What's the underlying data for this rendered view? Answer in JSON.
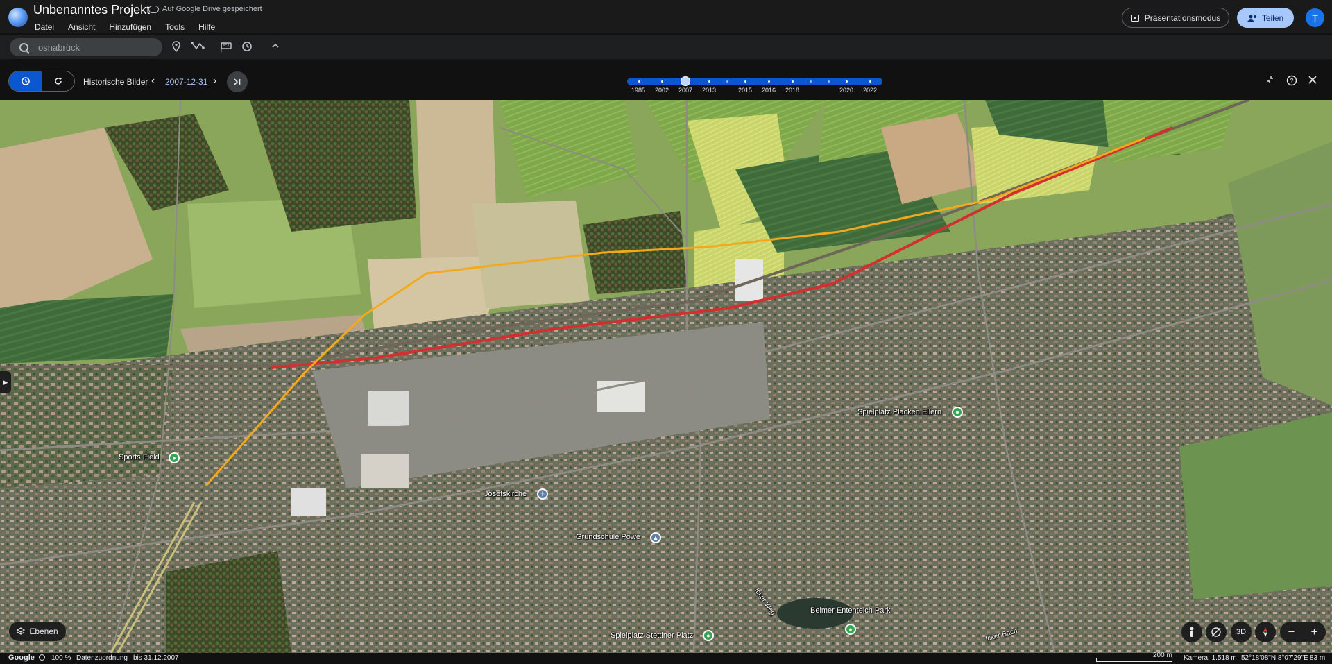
{
  "app": {
    "project_title": "Unbenanntes Projekt",
    "save_status": "Auf Google Drive gespeichert",
    "menu": [
      "Datei",
      "Ansicht",
      "Hinzufügen",
      "Tools",
      "Hilfe"
    ],
    "present_label": "Präsentationsmodus",
    "share_label": "Teilen",
    "avatar_letter": "T"
  },
  "toolbar": {
    "search_value": "osnabrück",
    "icons": [
      "search-icon",
      "place-pin-icon",
      "path-icon",
      "ruler-icon",
      "historical-imagery-icon",
      "collapse-chevron-icon"
    ]
  },
  "historical": {
    "label": "Historische Bilder",
    "date": "2007-12-31",
    "timeline_years": [
      "1985",
      "2002",
      "2007",
      "2013",
      "2015",
      "2016",
      "2018",
      "2020",
      "2022"
    ],
    "selected_year": "2007"
  },
  "map": {
    "pois": [
      {
        "label": "Sports Field",
        "color": "#34a853"
      },
      {
        "label": "Josefskirche",
        "color": "#5f7fa6"
      },
      {
        "label": "Grundschule Powe",
        "color": "#5f7fa6"
      },
      {
        "label": "Spielplatz Placken Ellern",
        "color": "#34a853"
      },
      {
        "label": "Belmer Ententeich Park",
        "color": "#34a853"
      },
      {
        "label": "Spielplatz Stettiner Platz",
        "color": "#34a853"
      }
    ],
    "street_labels": [
      "Icker Weg",
      "Icker Bach"
    ],
    "overlay_colors": {
      "rail_line": "#d32f2f",
      "path_line": "#f2a91e"
    }
  },
  "controls": {
    "layers_label": "Ebenen",
    "view_3d_label": "3D",
    "zoom_out": "−",
    "zoom_in": "+"
  },
  "status": {
    "brand": "Google",
    "zoom_percent": "100 %",
    "attribution": "Datenzuordnung",
    "imagery_date": "bis 31.12.2007",
    "scale": "200 m",
    "camera": "Kamera: 1.518 m",
    "coords": "52°18'08\"N 8°07'29\"E",
    "elevation": "83 m"
  }
}
